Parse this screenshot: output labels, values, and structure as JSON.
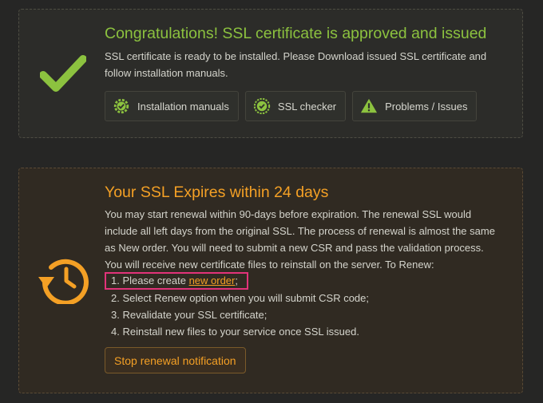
{
  "approved": {
    "title": "Congratulations! SSL certificate is approved and issued",
    "description": "SSL certificate is ready to be installed. Please Download issued SSL certificate and follow installation manuals.",
    "icon": "checkmark-icon",
    "accent": "#8cc23f",
    "buttons": [
      {
        "label": "Installation manuals",
        "icon": "gear-icon"
      },
      {
        "label": "SSL checker",
        "icon": "badge-check-icon"
      },
      {
        "label": "Problems / Issues",
        "icon": "warning-icon"
      }
    ]
  },
  "expiry": {
    "title": "Your SSL Expires within 24 days",
    "description": "You may start renewal within 90-days before expiration. The renewal SSL would include all left days from the original SSL. The process of renewal is almost the same as New order. You will need to submit a new CSR and pass the validation process. You will receive new certificate files to reinstall on the server. To Renew:",
    "icon": "history-clock-icon",
    "accent": "#f4a025",
    "steps": {
      "step1_prefix": "1. Please create ",
      "step1_link": "new order",
      "step1_suffix": ";",
      "step2": "2. Select Renew option when you will submit CSR code;",
      "step3": "3. Revalidate your SSL certificate;",
      "step4": "4. Reinstall new files to your service once SSL issued."
    },
    "stop_button": "Stop renewal notification"
  }
}
